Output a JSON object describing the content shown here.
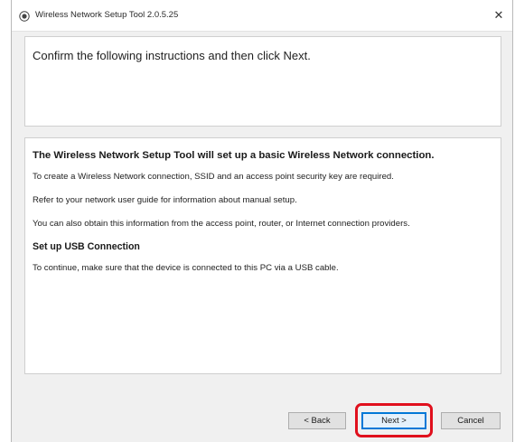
{
  "window": {
    "title": "Wireless Network Setup Tool 2.0.5.25",
    "close_glyph": "✕"
  },
  "header": {
    "instruction": "Confirm the following instructions and then click Next."
  },
  "content": {
    "heading": "The Wireless Network Setup Tool will set up a basic Wireless Network connection.",
    "para1": "To create a Wireless Network connection, SSID and an access point security key are required.",
    "para2": "Refer to your network user guide for information about manual setup.",
    "para3": "You can also obtain this information from the access point, router, or Internet connection providers.",
    "subheading": "Set up USB Connection",
    "para4": "To continue, make sure that the device is connected to this PC via a USB cable."
  },
  "buttons": {
    "back": "< Back",
    "next": "Next >",
    "cancel": "Cancel"
  },
  "colors": {
    "highlight": "#e0101d",
    "next_border": "#0078d7"
  },
  "icons": {
    "app": "app-icon",
    "close": "close-icon"
  }
}
